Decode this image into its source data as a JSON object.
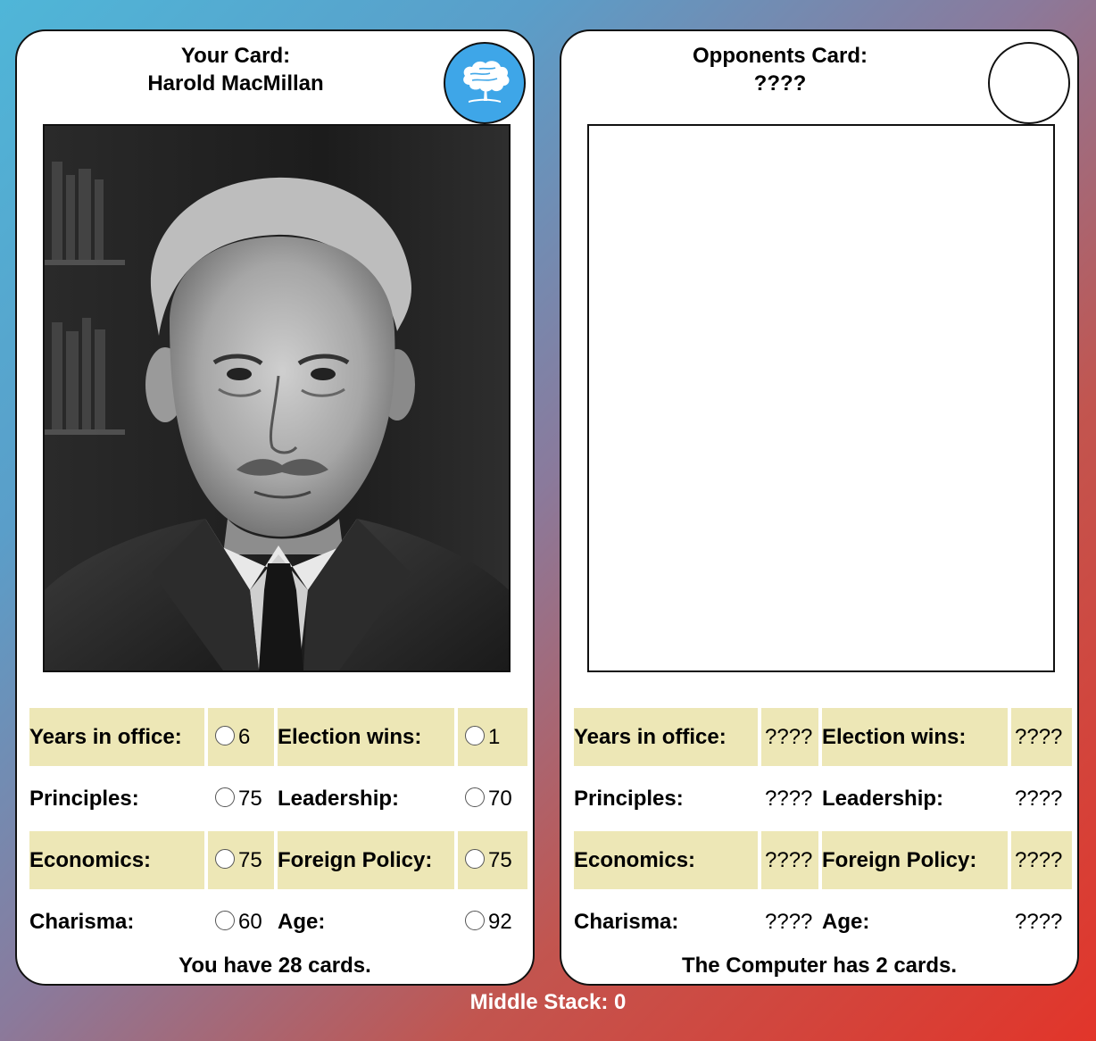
{
  "player": {
    "heading": "Your Card:",
    "name": "Harold MacMillan",
    "party_color": "#3ea6e8",
    "party_icon": "oak-tree-icon",
    "stats": [
      {
        "label1": "Years in office:",
        "value1": "6",
        "label2": "Election wins:",
        "value2": "1"
      },
      {
        "label1": "Principles:",
        "value1": "75",
        "label2": "Leadership:",
        "value2": "70"
      },
      {
        "label1": "Economics:",
        "value1": "75",
        "label2": "Foreign Policy:",
        "value2": "75"
      },
      {
        "label1": "Charisma:",
        "value1": "60",
        "label2": "Age:",
        "value2": "92"
      }
    ],
    "footer": "You have 28 cards."
  },
  "opponent": {
    "heading": "Opponents Card:",
    "name": "????",
    "stats": [
      {
        "label1": "Years in office:",
        "value1": "????",
        "label2": "Election wins:",
        "value2": "????"
      },
      {
        "label1": "Principles:",
        "value1": "????",
        "label2": "Leadership:",
        "value2": "????"
      },
      {
        "label1": "Economics:",
        "value1": "????",
        "label2": "Foreign Policy:",
        "value2": "????"
      },
      {
        "label1": "Charisma:",
        "value1": "????",
        "label2": "Age:",
        "value2": "????"
      }
    ],
    "footer": "The Computer has 2 cards."
  },
  "middle_stack": "Middle Stack: 0",
  "colors": {
    "stat_row_shade": "#ede7b6",
    "gradient_start": "#4fb6d8",
    "gradient_end": "#e2352a"
  }
}
